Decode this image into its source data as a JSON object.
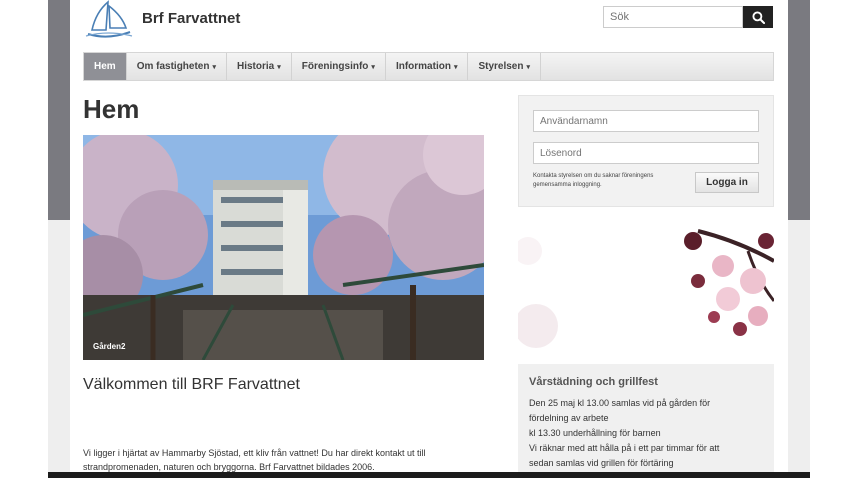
{
  "site": {
    "name": "Brf Farvattnet",
    "logo_icon": "sailboat-icon"
  },
  "search": {
    "placeholder": "Sök",
    "icon": "search-icon"
  },
  "nav": {
    "items": [
      {
        "label": "Hem",
        "active": true
      },
      {
        "label": "Om fastigheten",
        "dropdown": true
      },
      {
        "label": "Historia",
        "dropdown": true
      },
      {
        "label": "Föreningsinfo",
        "dropdown": true
      },
      {
        "label": "Information",
        "dropdown": true
      },
      {
        "label": "Styrelsen",
        "dropdown": true
      }
    ],
    "caret": "▾"
  },
  "main": {
    "title": "Hem",
    "hero": {
      "caption": "Gården2"
    },
    "welcome_heading": "Välkommen till BRF Farvattnet",
    "intro_text": "Vi ligger i hjärtat av Hammarby Sjöstad, ett kliv från vattnet! Du har direkt kontakt ut till strandpromenaden, naturen och bryggorna. Brf Farvattnet bildades 2006."
  },
  "login": {
    "username_placeholder": "Användarnamn",
    "password_placeholder": "Lösenord",
    "hint": "Kontakta styrelsen om du saknar föreningens gemensamma inloggning.",
    "button_label": "Logga in"
  },
  "news": {
    "title": "Vårstädning och grillfest",
    "lines": [
      "Den 25 maj kl 13.00 samlas vid på gården för",
      "fördelning av arbete",
      "kl 13.30 underhållning för barnen",
      "Vi räknar med att hålla på i ett par timmar för att",
      "sedan samlas vid grillen för förtäring"
    ]
  },
  "colors": {
    "nav_active": "#8f9096",
    "search_button": "#222222",
    "news_bg": "#f0f0f0"
  }
}
